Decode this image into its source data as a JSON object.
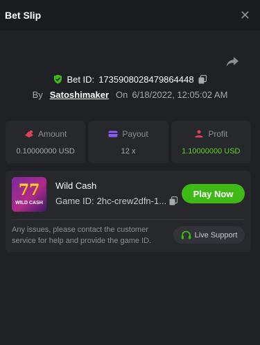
{
  "header": {
    "title": "Bet Slip"
  },
  "bet": {
    "id_label": "Bet ID:",
    "id_value": "1735908028479864448",
    "by_label": "By",
    "username": "Satoshimaker",
    "on_label": "On",
    "datetime": "6/18/2022, 12:05:02 AM"
  },
  "stats": {
    "amount": {
      "label": "Amount",
      "value": "0.10000000 USD"
    },
    "payout": {
      "label": "Payout",
      "value": "12 x"
    },
    "profit": {
      "label": "Profit",
      "value": "1.10000000 USD"
    }
  },
  "game": {
    "thumb_number": "77",
    "thumb_text": "WILD CASH",
    "name": "Wild Cash",
    "id_label": "Game ID:",
    "id_value": "2hc-crew2dfn-1...",
    "play_label": "Play Now"
  },
  "support": {
    "text": "Any issues, please contact the customer service for help and provide the game ID.",
    "button_label": "Live Support"
  },
  "colors": {
    "accent_green": "#3fb916",
    "profit_green": "#5ad31a",
    "amount_icon": "#e0405a",
    "payout_icon": "#8a5cf6",
    "profit_icon": "#e0405a"
  },
  "icons": [
    "close-icon",
    "share-icon",
    "shield-check-icon",
    "copy-icon",
    "coins-icon",
    "wallet-icon",
    "profit-icon",
    "headset-icon"
  ]
}
